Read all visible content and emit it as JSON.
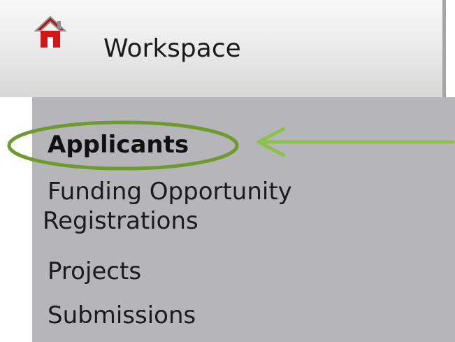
{
  "header": {
    "title": "Workspace",
    "icon": "home-icon"
  },
  "menu": {
    "items": [
      {
        "label": "Applicants",
        "active": true
      },
      {
        "label_line1": "Funding Opportunity",
        "label_line2": "Registrations"
      },
      {
        "label": "Projects"
      },
      {
        "label": "Submissions"
      }
    ]
  },
  "annotation": {
    "shape": "ellipse-with-arrow",
    "color": "#6f9a2f",
    "arrow_color": "#8bc34a",
    "target": "Applicants"
  },
  "colors": {
    "menu_background": "#b6b5ba",
    "header_background": "#ebebeb",
    "home_roof": "#b11616"
  }
}
